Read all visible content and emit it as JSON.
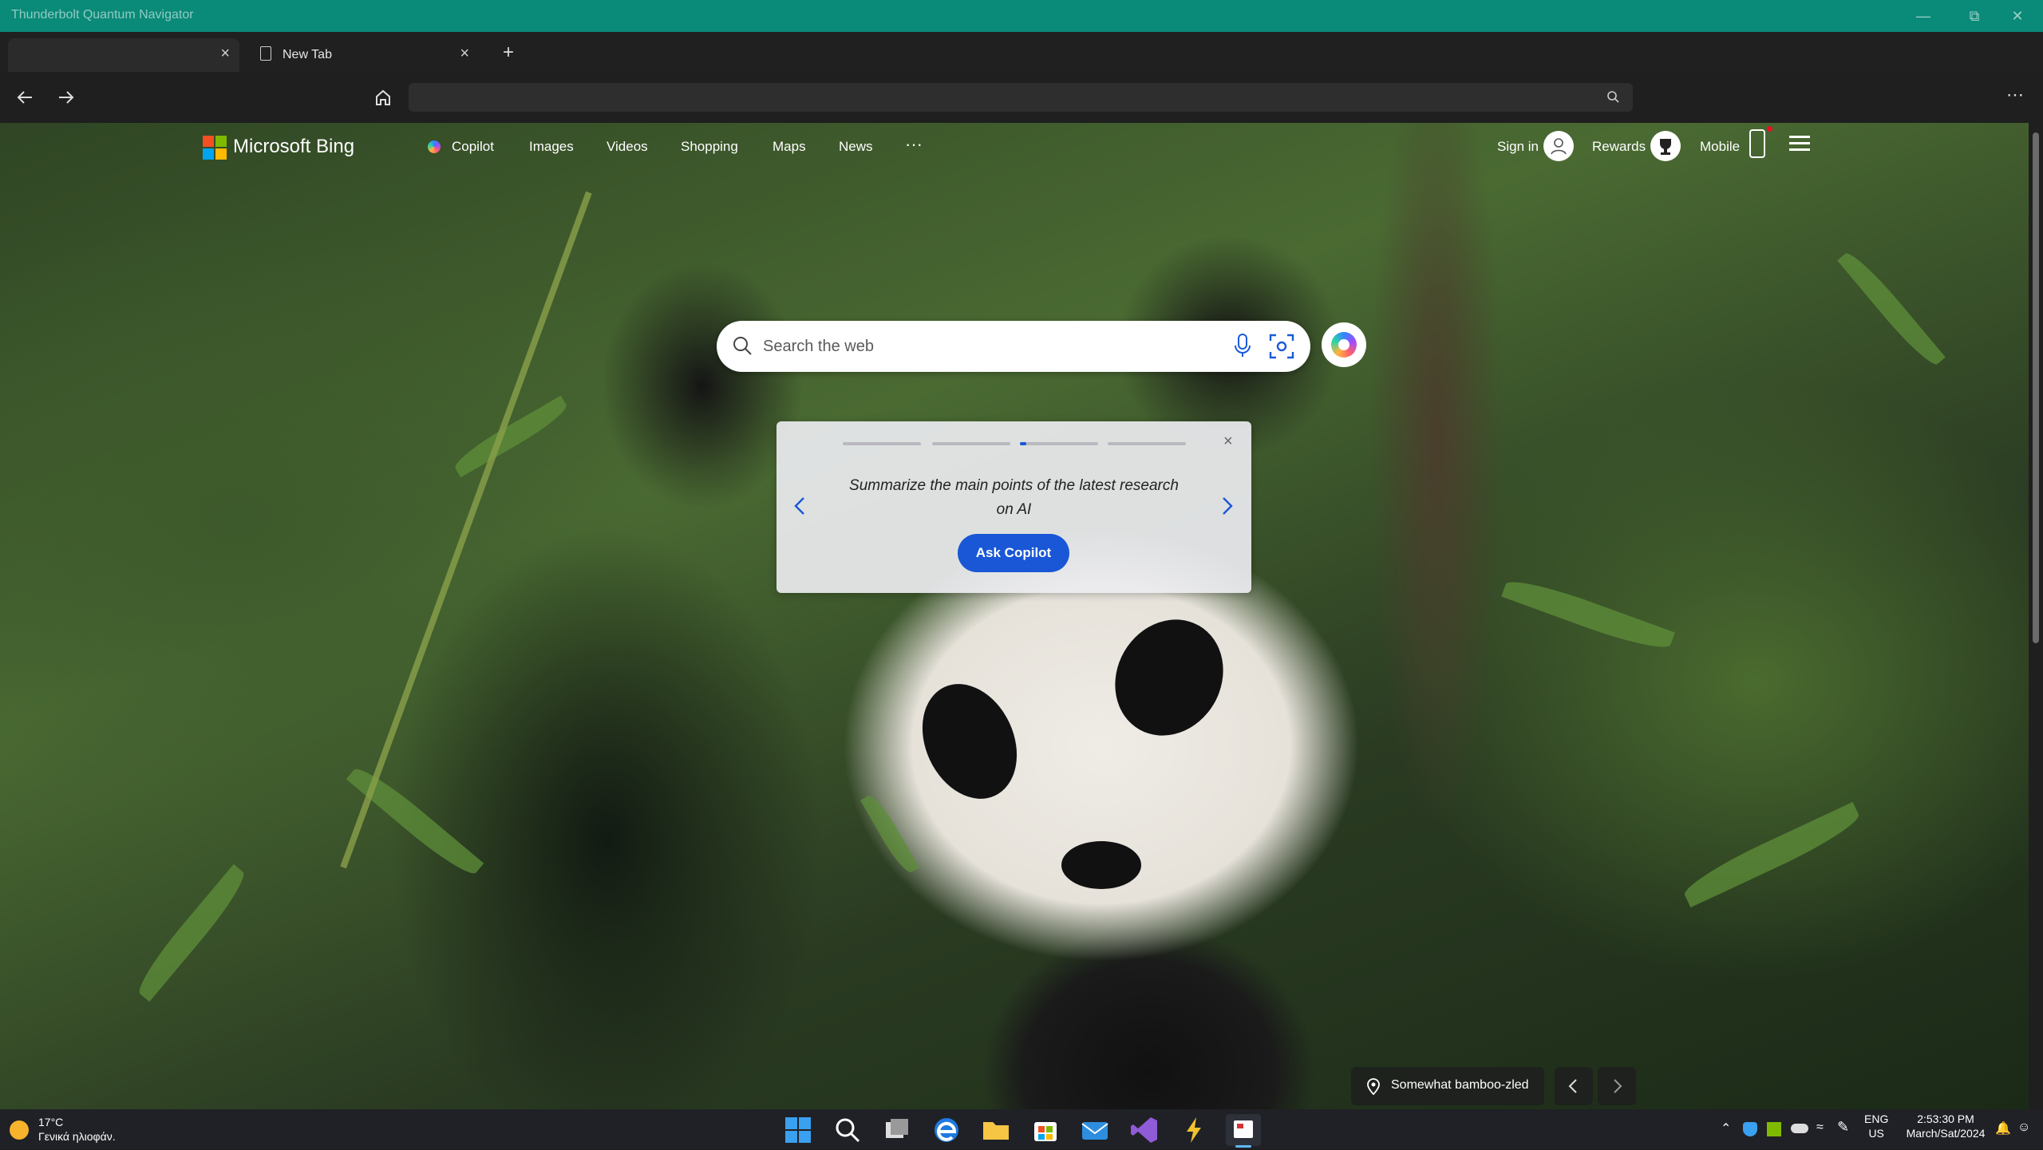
{
  "window": {
    "title": "Thunderbolt Quantum Navigator"
  },
  "tabs": [
    {
      "label": ""
    },
    {
      "label": "New Tab"
    }
  ],
  "addressbar": {
    "value": ""
  },
  "bing": {
    "logo_text": "Microsoft Bing",
    "nav": [
      "Copilot",
      "Images",
      "Videos",
      "Shopping",
      "Maps",
      "News"
    ],
    "more_label": "···",
    "sign_in": "Sign in",
    "rewards": "Rewards",
    "mobile": "Mobile"
  },
  "search": {
    "placeholder": "Search the web"
  },
  "prompt_card": {
    "text": "Summarize the main points of the latest research on AI",
    "button": "Ask Copilot",
    "active_step": 3,
    "steps": 4
  },
  "image_info": {
    "caption": "Somewhat bamboo-zled"
  },
  "weather": {
    "temp": "17°C",
    "desc": "Γενικά ηλιοφάν."
  },
  "tray": {
    "lang": "ENG",
    "region": "US",
    "time": "2:53:30 PM",
    "date": "March/Sat/2024"
  },
  "colors": {
    "titlebar": "#0a8a78",
    "ask_button": "#1957d6",
    "taskbar": "#1f2126"
  }
}
